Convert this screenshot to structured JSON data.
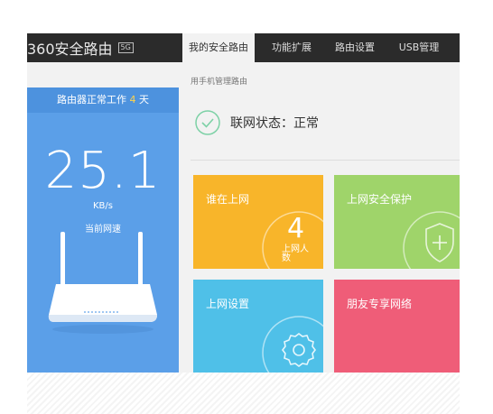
{
  "app": {
    "logo_text": "360安全路由",
    "logo_badge": "5G"
  },
  "tabs": [
    {
      "label": "我的安全路由",
      "active": true
    },
    {
      "label": "功能扩展",
      "active": false
    },
    {
      "label": "路由设置",
      "active": false
    },
    {
      "label": "USB管理",
      "active": false
    }
  ],
  "sidebar": {
    "header_prefix": "路由器正常工作",
    "uptime_value": "4",
    "uptime_unit": "天",
    "speed_value": "25.1",
    "speed_unit": "KB/s",
    "speed_label": "当前网速"
  },
  "main": {
    "subline": "用手机管理路由",
    "status_text": "联网状态：正常",
    "tiles": [
      {
        "title": "谁在上网",
        "count": "4",
        "count_label": "上网人数",
        "color": "#f8b52a"
      },
      {
        "title": "上网安全保护",
        "color": "#9fd46a"
      },
      {
        "title": "上网设置",
        "color": "#4fc0e8"
      },
      {
        "title": "朋友专享网络",
        "color": "#ef5d78"
      }
    ]
  },
  "colors": {
    "topbar": "#2b2b2b",
    "sidebar": "#5b9fe8",
    "accent_yellow": "#ffd34a",
    "status_ok": "#7dd1a6"
  },
  "icons": {
    "status": "check-circle-icon",
    "security": "shield-plus-icon",
    "settings": "gear-icon"
  }
}
